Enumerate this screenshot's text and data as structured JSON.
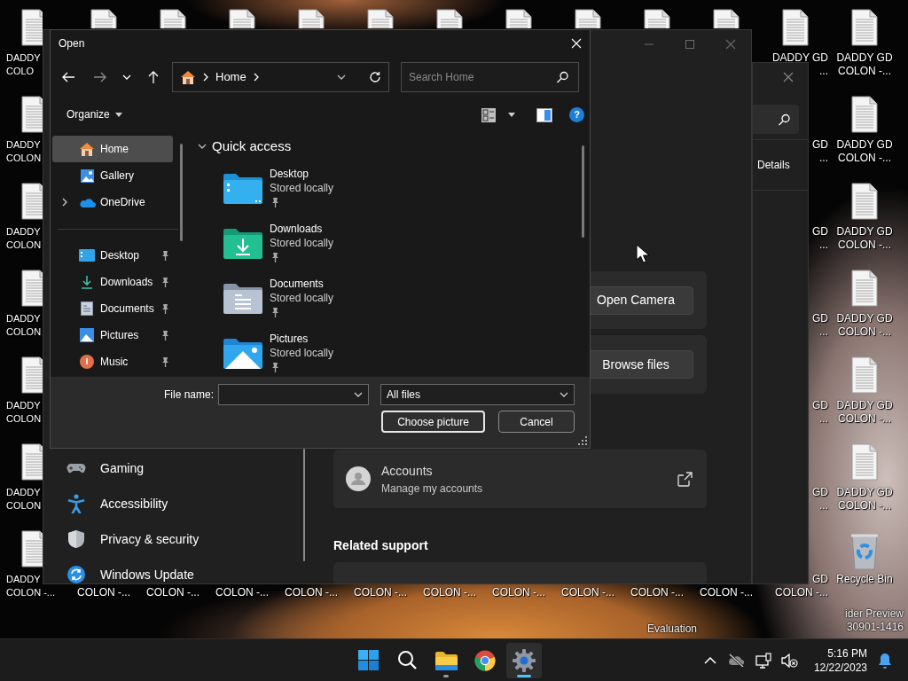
{
  "desktop_icons": [
    {
      "kind": "document",
      "label_lines": [
        "DADDY",
        "COLO"
      ]
    },
    {
      "kind": "document"
    },
    {
      "kind": "document"
    },
    {
      "kind": "document"
    },
    {
      "kind": "document"
    },
    {
      "kind": "document"
    },
    {
      "kind": "document"
    },
    {
      "kind": "document"
    },
    {
      "kind": "document"
    },
    {
      "kind": "document"
    },
    {
      "kind": "document"
    },
    {
      "kind": "document",
      "label_lines": [
        "DADDY GD",
        "..."
      ]
    },
    {
      "kind": "document",
      "label_lines": [
        "DADDY GD",
        "COLON -..."
      ]
    },
    {
      "kind": "document",
      "label_lines": [
        "DADDY",
        "COLON"
      ]
    },
    {
      "kind": "label_only",
      "label_lines": [
        "GD",
        "..."
      ]
    },
    {
      "kind": "document",
      "label_lines": [
        "DADDY GD",
        "COLON -..."
      ]
    },
    {
      "kind": "document",
      "label_lines": [
        "DADDY",
        "COLON"
      ]
    },
    {
      "kind": "label_only",
      "label_lines": [
        "GD",
        "..."
      ]
    },
    {
      "kind": "document",
      "label_lines": [
        "DADDY GD",
        "COLON -..."
      ]
    },
    {
      "kind": "document",
      "label_lines": [
        "DADDY",
        "COLON"
      ]
    },
    {
      "kind": "label_only",
      "label_lines": [
        "GD",
        "..."
      ]
    },
    {
      "kind": "document",
      "label_lines": [
        "DADDY GD",
        "COLON -..."
      ]
    },
    {
      "kind": "document",
      "label_lines": [
        "DADDY",
        "COLON"
      ]
    },
    {
      "kind": "label_only",
      "label_lines": [
        "GD",
        "..."
      ]
    },
    {
      "kind": "document",
      "label_lines": [
        "DADDY GD",
        "COLON -..."
      ]
    },
    {
      "kind": "document",
      "label_lines": [
        "DADDY",
        "COLON"
      ]
    },
    {
      "kind": "label_only",
      "label_lines": [
        "GD",
        "..."
      ]
    },
    {
      "kind": "document",
      "label_lines": [
        "DADDY GD",
        "COLON -..."
      ]
    },
    {
      "kind": "document",
      "label_lines": [
        "DADDY",
        "COLON -..."
      ]
    },
    {
      "kind": "label_only",
      "label_lines": [
        "COLON -..."
      ]
    },
    {
      "kind": "label_only",
      "label_lines": [
        "COLON -..."
      ]
    },
    {
      "kind": "label_only",
      "label_lines": [
        "COLON -..."
      ]
    },
    {
      "kind": "label_only",
      "label_lines": [
        "COLON -..."
      ]
    },
    {
      "kind": "label_only",
      "label_lines": [
        "COLON -..."
      ]
    },
    {
      "kind": "label_only",
      "label_lines": [
        "COLON -..."
      ]
    },
    {
      "kind": "label_only",
      "label_lines": [
        "COLON -..."
      ]
    },
    {
      "kind": "label_only",
      "label_lines": [
        "COLON -..."
      ]
    },
    {
      "kind": "label_only",
      "label_lines": [
        "COLON -..."
      ]
    },
    {
      "kind": "label_only",
      "label_lines": [
        "COLON -..."
      ]
    },
    {
      "kind": "label_only",
      "label_lines": [
        "GD",
        "COLON -..."
      ]
    },
    {
      "kind": "recycle_bin",
      "label_lines": [
        "Recycle Bin"
      ]
    }
  ],
  "settings_window": {
    "nav_items": [
      {
        "kind": "gaming",
        "label": "Gaming"
      },
      {
        "kind": "accessibility",
        "label": "Accessibility"
      },
      {
        "kind": "privacy",
        "label": "Privacy & security"
      },
      {
        "kind": "update",
        "label": "Windows Update"
      }
    ],
    "photo_buttons": [
      "Open Camera",
      "Browse files"
    ],
    "accounts_card": {
      "title": "Accounts",
      "subtitle": "Manage my accounts"
    },
    "related_support_heading": "Related support"
  },
  "side_window": {
    "tab_label": "Details"
  },
  "open_dialog": {
    "title": "Open",
    "address_crumbs": [
      "Home"
    ],
    "search": {
      "placeholder": "Search Home"
    },
    "organize_label": "Organize",
    "help_glyph": "?",
    "nav_pane": [
      {
        "kind": "home",
        "label": "Home",
        "selected": true,
        "expandable": false,
        "pinned": false
      },
      {
        "kind": "gallery",
        "label": "Gallery",
        "selected": false,
        "expandable": false,
        "pinned": false
      },
      {
        "kind": "onedrive",
        "label": "OneDrive",
        "selected": false,
        "expandable": true,
        "pinned": false
      },
      {
        "kind": "divider"
      },
      {
        "kind": "desktop",
        "label": "Desktop",
        "selected": false,
        "expandable": false,
        "pinned": true
      },
      {
        "kind": "downloads",
        "label": "Downloads",
        "selected": false,
        "expandable": false,
        "pinned": true
      },
      {
        "kind": "documents",
        "label": "Documents",
        "selected": false,
        "expandable": false,
        "pinned": true
      },
      {
        "kind": "pictures",
        "label": "Pictures",
        "selected": false,
        "expandable": false,
        "pinned": true
      },
      {
        "kind": "music",
        "label": "Music",
        "selected": false,
        "expandable": false,
        "pinned": true
      }
    ],
    "section": {
      "title": "Quick access",
      "expanded": true
    },
    "quick_access": [
      {
        "kind": "desktop",
        "name": "Desktop",
        "status": "Stored locally",
        "pinned": true
      },
      {
        "kind": "downloads",
        "name": "Downloads",
        "status": "Stored locally",
        "pinned": true
      },
      {
        "kind": "documents",
        "name": "Documents",
        "status": "Stored locally",
        "pinned": true
      },
      {
        "kind": "pictures",
        "name": "Pictures",
        "status": "Stored locally",
        "pinned": true
      }
    ],
    "file_name_label": "File name:",
    "file_type": "All files",
    "buttons": [
      {
        "label": "Choose picture",
        "default": true
      },
      {
        "label": "Cancel",
        "default": false
      }
    ]
  },
  "os_watermark": {
    "left_text": "Evaluation",
    "right_lines": [
      "ider Preview",
      "30901-1416"
    ]
  },
  "taskbar": {
    "apps": [
      {
        "kind": "start",
        "active": false,
        "running": false
      },
      {
        "kind": "search",
        "active": false,
        "running": false
      },
      {
        "kind": "explorer",
        "active": false,
        "running": true
      },
      {
        "kind": "browser",
        "active": false,
        "running": false
      },
      {
        "kind": "settings",
        "active": true,
        "running": true
      }
    ],
    "time": "5:16 PM",
    "date": "12/22/2023"
  }
}
